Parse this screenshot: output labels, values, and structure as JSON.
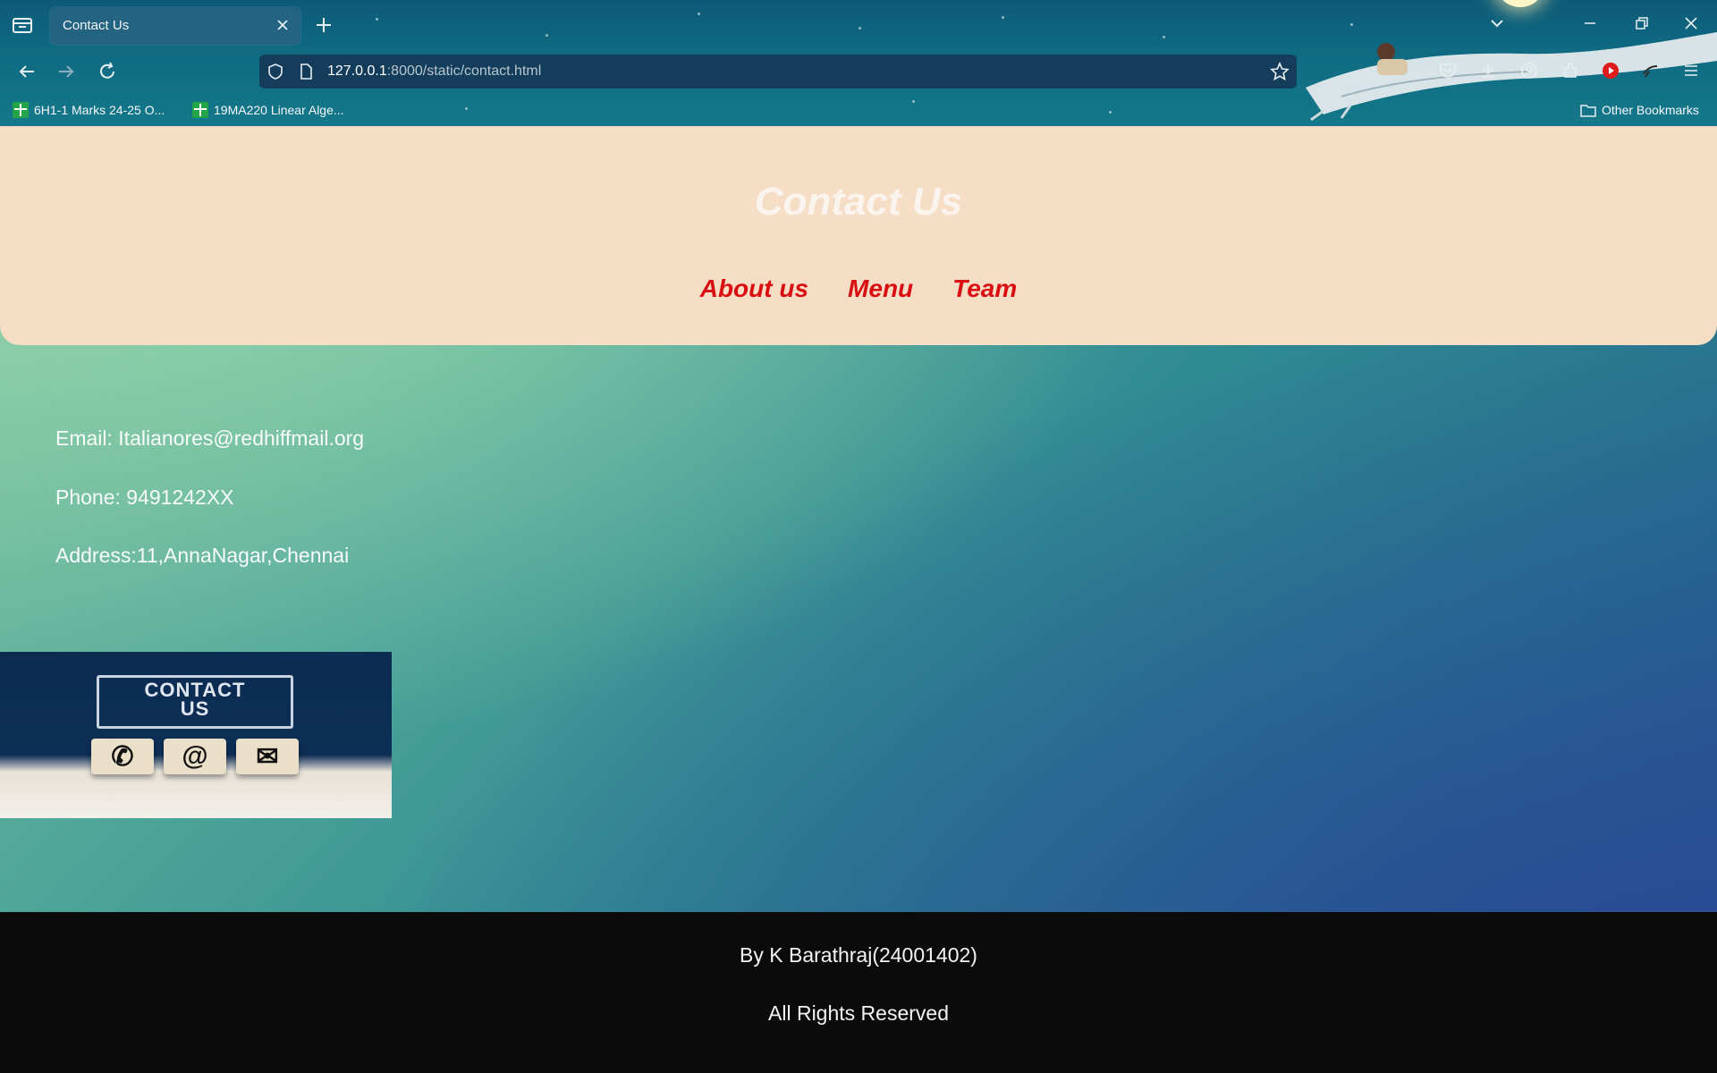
{
  "browser": {
    "tab_title": "Contact Us",
    "url_host": "127.0.0.1",
    "url_rest": ":8000/static/contact.html",
    "bookmarks": [
      {
        "label": "6H1-1 Marks 24-25 O...",
        "icon": "sheets-icon"
      },
      {
        "label": "19MA220 Linear Alge...",
        "icon": "sheets-icon"
      }
    ],
    "other_bookmarks": "Other Bookmarks"
  },
  "header": {
    "title": "Contact Us",
    "nav": [
      "About us",
      "Menu",
      "Team"
    ]
  },
  "contact": {
    "email": "Email: Italianores@redhiffmail.org",
    "phone": "Phone: 9491242XX",
    "address": "Address:11,AnnaNagar,Chennai"
  },
  "image": {
    "caption_line1": "CONTACT",
    "caption_line2": "US",
    "cube_icons": [
      "phone-icon",
      "at-icon",
      "envelope-icon"
    ]
  },
  "footer": {
    "author": "By K Barathraj(24001402)",
    "rights": "All Rights Reserved"
  },
  "colors": {
    "header_bg": "#f5dec5",
    "nav_link": "#d80e12",
    "footer_bg": "#0b0b0b"
  }
}
